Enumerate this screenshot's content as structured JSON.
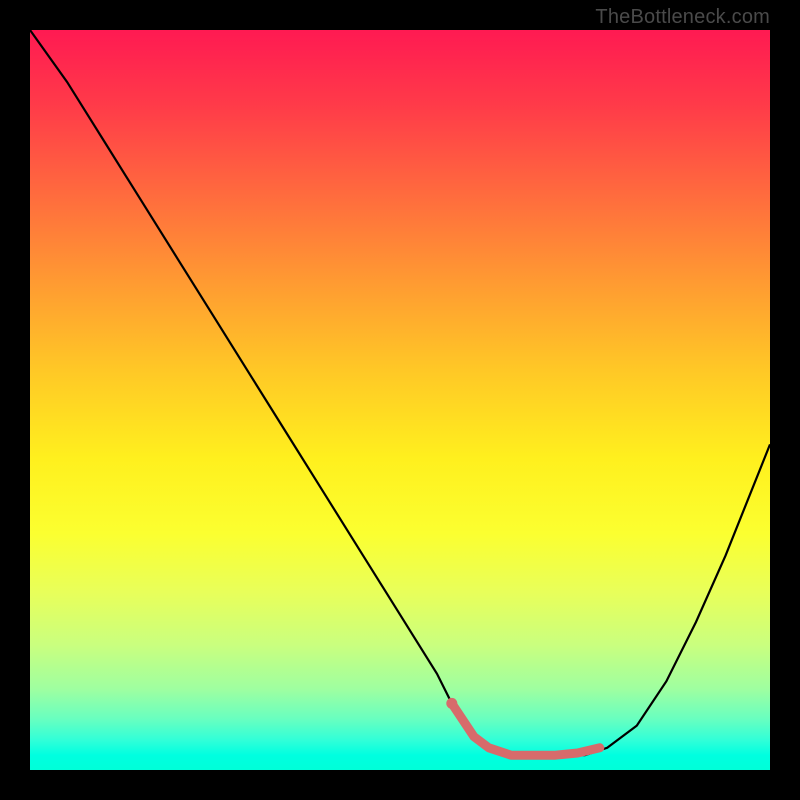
{
  "watermark": "TheBottleneck.com",
  "colors": {
    "frame": "#000000",
    "curve_stroke": "#000000",
    "marker_stroke": "#d76b6b",
    "marker_fill": "#d76b6b"
  },
  "chart_data": {
    "type": "line",
    "title": "",
    "xlabel": "",
    "ylabel": "",
    "xlim": [
      0,
      100
    ],
    "ylim": [
      0,
      100
    ],
    "series": [
      {
        "name": "bottleneck-curve",
        "x": [
          0,
          5,
          10,
          15,
          20,
          25,
          30,
          35,
          40,
          45,
          50,
          55,
          57,
          60,
          62,
          65,
          70,
          75,
          78,
          82,
          86,
          90,
          94,
          100
        ],
        "values": [
          100,
          93,
          85,
          77,
          69,
          61,
          53,
          45,
          37,
          29,
          21,
          13,
          9,
          4.5,
          3,
          2,
          2,
          2,
          3,
          6,
          12,
          20,
          29,
          44
        ]
      }
    ],
    "markers": {
      "name": "optimal-range",
      "x": [
        57,
        60,
        62,
        65,
        68,
        71,
        74,
        77
      ],
      "values": [
        9,
        4.5,
        3,
        2,
        2,
        2,
        2.3,
        3
      ]
    }
  }
}
